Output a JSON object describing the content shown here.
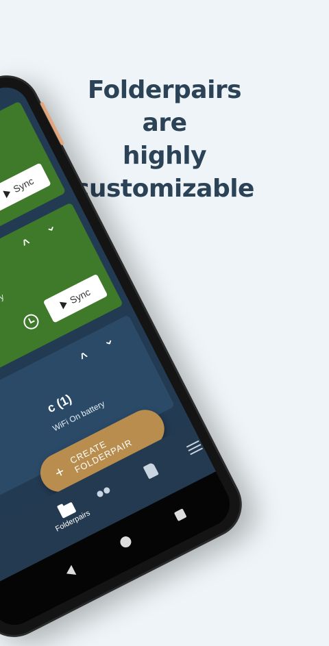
{
  "headline": {
    "line1": "Folderpairs are",
    "line2": "highly",
    "line3": "customizable"
  },
  "cards": {
    "card1": {
      "sync_label": "Sync"
    },
    "card2": {
      "status": "battery",
      "sync_label": "Sync"
    },
    "card3": {
      "title": "c (1)",
      "status": "WiFi On battery"
    }
  },
  "fab": {
    "label": "CREATE FOLDERPAIR"
  },
  "bottom_nav": {
    "folderpairs_label": "Folderpairs"
  },
  "icons": {
    "sync": "play-icon",
    "history": "history-icon",
    "expand": "chevron-icons",
    "accounts": "people-icon",
    "sdcard": "sd-card-icon",
    "menu": "menu-icon"
  },
  "colors": {
    "green_card": "#3f7a2a",
    "blue_card": "#2a4a68",
    "fab": "#b88d4d",
    "headline": "#2c4257"
  }
}
